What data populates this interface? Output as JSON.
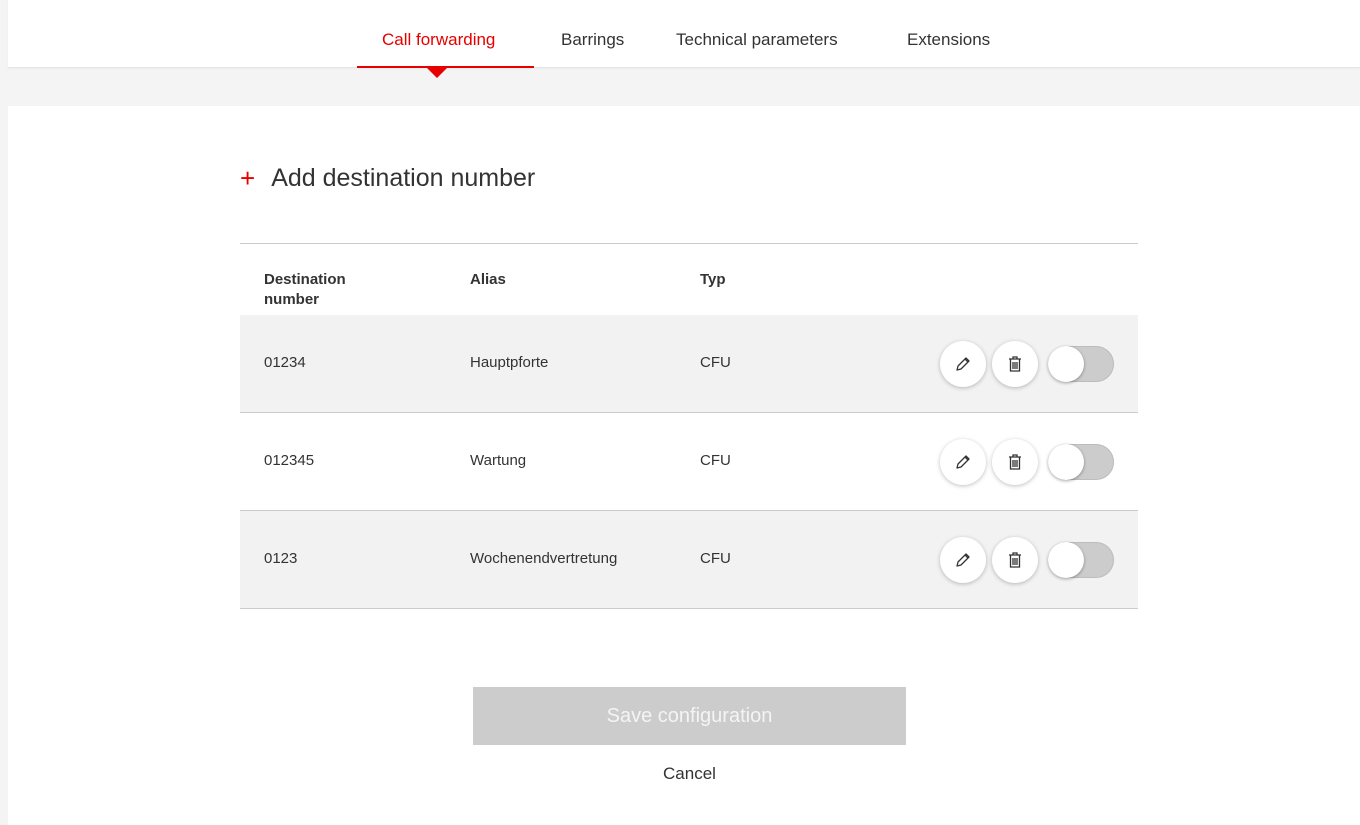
{
  "tabs": [
    {
      "label": "Call forwarding",
      "active": true
    },
    {
      "label": "Barrings",
      "active": false
    },
    {
      "label": "Technical parameters",
      "active": false
    },
    {
      "label": "Extensions",
      "active": false
    }
  ],
  "add_destination": {
    "icon": "plus-icon",
    "label": "Add destination number"
  },
  "table": {
    "headers": {
      "destination": "Destination number",
      "alias": "Alias",
      "typ": "Typ"
    },
    "rows": [
      {
        "destination": "01234",
        "alias": "Hauptpforte",
        "typ": "CFU",
        "enabled": false
      },
      {
        "destination": "012345",
        "alias": "Wartung",
        "typ": "CFU",
        "enabled": false
      },
      {
        "destination": "0123",
        "alias": "Wochenendvertretung",
        "typ": "CFU",
        "enabled": false
      }
    ]
  },
  "buttons": {
    "save_label": "Save configuration",
    "save_disabled": true,
    "cancel_label": "Cancel"
  },
  "colors": {
    "accent": "#e60000",
    "disabled": "#cccccc",
    "row_shade": "#f2f2f2"
  }
}
